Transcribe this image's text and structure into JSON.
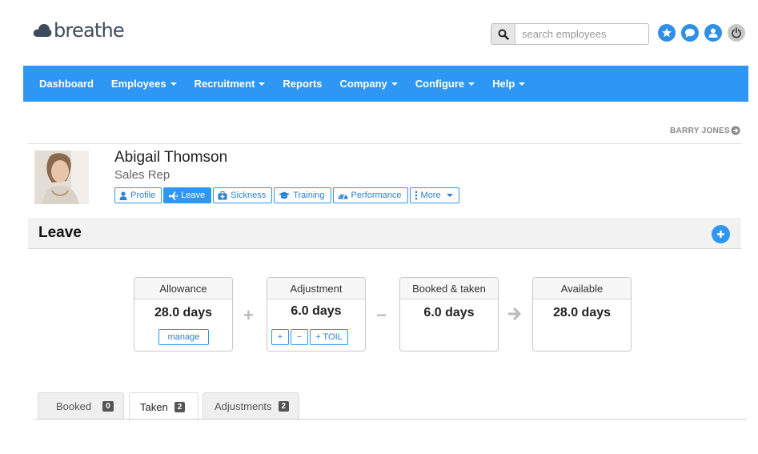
{
  "brand": {
    "name": "breathe"
  },
  "search": {
    "placeholder": "search employees"
  },
  "top_icons": [
    "star-icon",
    "chat-icon",
    "user-icon",
    "power-icon"
  ],
  "nav": {
    "items": [
      {
        "label": "Dashboard",
        "dropdown": false
      },
      {
        "label": "Employees",
        "dropdown": true
      },
      {
        "label": "Recruitment",
        "dropdown": true
      },
      {
        "label": "Reports",
        "dropdown": false
      },
      {
        "label": "Company",
        "dropdown": true
      },
      {
        "label": "Configure",
        "dropdown": true
      },
      {
        "label": "Help",
        "dropdown": true
      }
    ]
  },
  "user": {
    "name": "BARRY JONES"
  },
  "employee": {
    "name": "Abigail Thomson",
    "role": "Sales Rep",
    "tabs": [
      {
        "label": "Profile",
        "icon": "user-icon"
      },
      {
        "label": "Leave",
        "icon": "plane-icon",
        "active": true
      },
      {
        "label": "Sickness",
        "icon": "medkit-icon"
      },
      {
        "label": "Training",
        "icon": "graduation-cap-icon"
      },
      {
        "label": "Performance",
        "icon": "dashboard-icon"
      },
      {
        "label": "More",
        "icon": "ellipsis-vertical-icon"
      }
    ]
  },
  "leave": {
    "title": "Leave",
    "cards": {
      "allowance": {
        "label": "Allowance",
        "value": "28.0 days",
        "action": "manage"
      },
      "adjustment": {
        "label": "Adjustment",
        "value": "6.0 days",
        "buttons": [
          "+",
          "−",
          "+ TOIL"
        ]
      },
      "booked": {
        "label": "Booked & taken",
        "value": "6.0 days"
      },
      "available": {
        "label": "Available",
        "value": "28.0 days"
      }
    },
    "operators": {
      "plus": "+",
      "minus": "−"
    }
  },
  "bottom_tabs": [
    {
      "label": "Booked",
      "count": "0"
    },
    {
      "label": "Taken",
      "count": "2",
      "active": true
    },
    {
      "label": "Adjustments",
      "count": "2"
    }
  ],
  "colors": {
    "primary": "#2e97f4",
    "text_dark": "#222222",
    "badge": "#555555"
  }
}
